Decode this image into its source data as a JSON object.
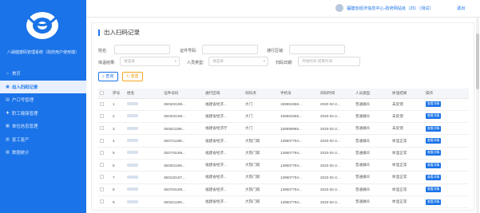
{
  "sidebar": {
    "app_title": "八闽健康码管理系统（政府用户使用端）",
    "items": [
      {
        "icon": "home-icon",
        "glyph": "⌂",
        "label": "首页",
        "active": false
      },
      {
        "icon": "qrcode-icon",
        "glyph": "▣",
        "label": "出入扫码记录",
        "active": true
      },
      {
        "icon": "id-card-icon",
        "glyph": "▤",
        "label": "户口号管理",
        "active": false
      },
      {
        "icon": "health-icon",
        "glyph": "✚",
        "label": "职工健康管理",
        "active": false
      },
      {
        "icon": "company-icon",
        "glyph": "▦",
        "label": "单位信息管理",
        "active": false
      },
      {
        "icon": "resume-work-icon",
        "glyph": "▥",
        "label": "复工复产",
        "active": false
      },
      {
        "icon": "report-icon",
        "glyph": "▧",
        "label": "数据统计",
        "active": false
      }
    ]
  },
  "header": {
    "user": "福建省经济信息中心-政府网站处（25）（测试）",
    "logout": "退出"
  },
  "panel": {
    "title": "出入扫码记录"
  },
  "filters": {
    "name_label": "姓名:",
    "idno_label": "证件号码:",
    "area_label": "通行区域:",
    "temp_label": "体温结果:",
    "temp_placeholder": "请选择",
    "persontype_label": "人员类型:",
    "persontype_placeholder": "请选择",
    "scandate_label": "扫码日期:",
    "scandate_placeholder": "开始时间-结束时间"
  },
  "buttons": {
    "query": "查询",
    "reset": "重置"
  },
  "table": {
    "columns": [
      "序号",
      "姓名",
      "证件号码",
      "通行区域",
      "扫码点",
      "手机号",
      "扫码时间",
      "人员类型",
      "体温结果",
      "操作"
    ],
    "action_label": "查看详情",
    "rows": [
      {
        "no": "1",
        "id": "350402198...",
        "area": "福建省经济...",
        "point": "大门",
        "phone": "159591556...",
        "time": "2020-02-2...",
        "type": "普通群众",
        "temp": "未反馈"
      },
      {
        "no": "2",
        "id": "350402198...",
        "area": "福建省经济...",
        "point": "大门",
        "phone": "159591556...",
        "time": "2020-02-2...",
        "type": "普通群众",
        "temp": "未反馈"
      },
      {
        "no": "3",
        "id": "350521198...",
        "area": "福建省经济厅",
        "point": "大门",
        "phone": "159599965...",
        "time": "2020-02-2...",
        "type": "普通群众",
        "temp": "未反馈"
      },
      {
        "no": "4",
        "id": "350721198...",
        "area": "福建省经济...",
        "point": "大院门岗",
        "phone": "139607794...",
        "time": "2020-02-2...",
        "type": "普通群众",
        "temp": "体温正常"
      },
      {
        "no": "5",
        "id": "352703198...",
        "area": "福建省经济...",
        "point": "大院门岗",
        "phone": "139607794...",
        "time": "2020-02-2...",
        "type": "普通群众",
        "temp": "体温正常"
      },
      {
        "no": "6",
        "id": "350301199...",
        "area": "福建省经济...",
        "point": "大院门岗",
        "phone": "139607794...",
        "time": "2020-02-2...",
        "type": "普通群众",
        "temp": "体温正常"
      },
      {
        "no": "7",
        "id": "350102197...",
        "area": "福建省经济...",
        "point": "大院门岗",
        "phone": "139607794...",
        "time": "2020-02-2...",
        "type": "普通群众",
        "temp": "体温正常"
      },
      {
        "no": "8",
        "id": "350784198...",
        "area": "福建省经济...",
        "point": "大院门岗",
        "phone": "139607794...",
        "time": "2020-02-2...",
        "type": "普通群众",
        "temp": "体温正常"
      },
      {
        "no": "9",
        "id": "350321199...",
        "area": "福建省经济...",
        "point": "大院门岗",
        "phone": "139607794...",
        "time": "2020-02-2...",
        "type": "普通群众",
        "temp": "体温正常"
      }
    ]
  }
}
